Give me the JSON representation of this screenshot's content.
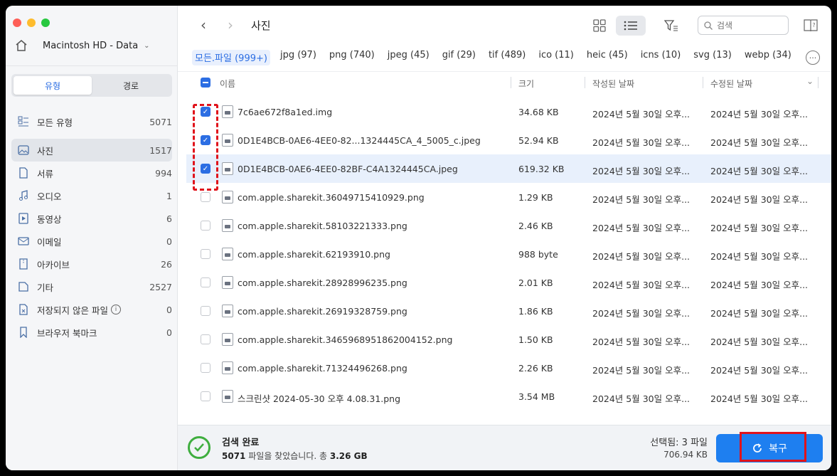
{
  "sidebar": {
    "drive": "Macintosh HD - Data",
    "segments": [
      "유형",
      "경로"
    ],
    "categories": [
      {
        "label": "모든 유형",
        "count": "5071",
        "icon": "all-types-icon"
      },
      {
        "label": "사진",
        "count": "1517",
        "icon": "photo-icon"
      },
      {
        "label": "서류",
        "count": "994",
        "icon": "document-icon"
      },
      {
        "label": "오디오",
        "count": "1",
        "icon": "audio-icon"
      },
      {
        "label": "동영상",
        "count": "6",
        "icon": "video-icon"
      },
      {
        "label": "이메일",
        "count": "0",
        "icon": "email-icon"
      },
      {
        "label": "아카이브",
        "count": "26",
        "icon": "archive-icon"
      },
      {
        "label": "기타",
        "count": "2527",
        "icon": "other-icon"
      },
      {
        "label": "저장되지 않은 파일",
        "count": "0",
        "icon": "unsaved-file-icon"
      },
      {
        "label": "브라우저 북마크",
        "count": "0",
        "icon": "bookmark-icon"
      }
    ]
  },
  "toolbar": {
    "title": "사진",
    "search_placeholder": "검색"
  },
  "filter_tabs": [
    "모든.파일 (999+)",
    "jpg (97)",
    "png (740)",
    "jpeg (45)",
    "gif (29)",
    "tif (489)",
    "ico (11)",
    "heic (45)",
    "icns (10)",
    "svg (13)",
    "webp (34)"
  ],
  "columns": {
    "name": "이름",
    "size": "크기",
    "created": "작성된 날짜",
    "modified": "수정된 날짜"
  },
  "files": [
    {
      "name": "7c6ae672f8a1ed.img",
      "size": "34.68 KB",
      "created": "2024년 5월 30일 오후...",
      "modified": "2024년 5월 30일 오후...",
      "checked": true
    },
    {
      "name": "0D1E4BCB-0AE6-4EE0-82...1324445CA_4_5005_c.jpeg",
      "size": "52.94 KB",
      "created": "2024년 5월 30일 오후...",
      "modified": "2024년 5월 30일 오후...",
      "checked": true
    },
    {
      "name": "0D1E4BCB-0AE6-4EE0-82BF-C4A1324445CA.jpeg",
      "size": "619.32 KB",
      "created": "2024년 5월 30일 오후...",
      "modified": "2024년 5월 30일 오후...",
      "checked": true
    },
    {
      "name": "com.apple.sharekit.36049715410929.png",
      "size": "1.29 KB",
      "created": "2024년 5월 30일 오후...",
      "modified": "2024년 5월 30일 오후...",
      "checked": false
    },
    {
      "name": "com.apple.sharekit.58103221333.png",
      "size": "2.46 KB",
      "created": "2024년 5월 30일 오후...",
      "modified": "2024년 5월 30일 오후...",
      "checked": false
    },
    {
      "name": "com.apple.sharekit.62193910.png",
      "size": "988 byte",
      "created": "2024년 5월 30일 오후...",
      "modified": "2024년 5월 30일 오후...",
      "checked": false
    },
    {
      "name": "com.apple.sharekit.28928996235.png",
      "size": "2.01 KB",
      "created": "2024년 5월 30일 오후...",
      "modified": "2024년 5월 30일 오후...",
      "checked": false
    },
    {
      "name": "com.apple.sharekit.26919328759.png",
      "size": "1.86 KB",
      "created": "2024년 5월 30일 오후...",
      "modified": "2024년 5월 30일 오후...",
      "checked": false
    },
    {
      "name": "com.apple.sharekit.3465968951862004152.png",
      "size": "1.50 KB",
      "created": "2024년 5월 30일 오후...",
      "modified": "2024년 5월 30일 오후...",
      "checked": false
    },
    {
      "name": "com.apple.sharekit.71324496268.png",
      "size": "2.26 KB",
      "created": "2024년 5월 30일 오후...",
      "modified": "2024년 5월 30일 오후...",
      "checked": false
    },
    {
      "name": "스크린샷 2024-05-30 오후 4.08.31.png",
      "size": "3.54 MB",
      "created": "2024년 5월 30일 오후...",
      "modified": "2024년 5월 30일 오후...",
      "checked": false
    }
  ],
  "footer": {
    "status": "검색 완료",
    "found_count": "5071",
    "found_text": "파일을 찾았습니다. 총",
    "found_size": "3.26 GB",
    "selected": "선택됨: 3 파일",
    "selected_size": "706.94 KB",
    "recover_label": "복구"
  },
  "colors": {
    "accent": "#2c6ee3",
    "button": "#1e7ff0",
    "annotation": "#e0131b",
    "success": "#3fae3f"
  }
}
